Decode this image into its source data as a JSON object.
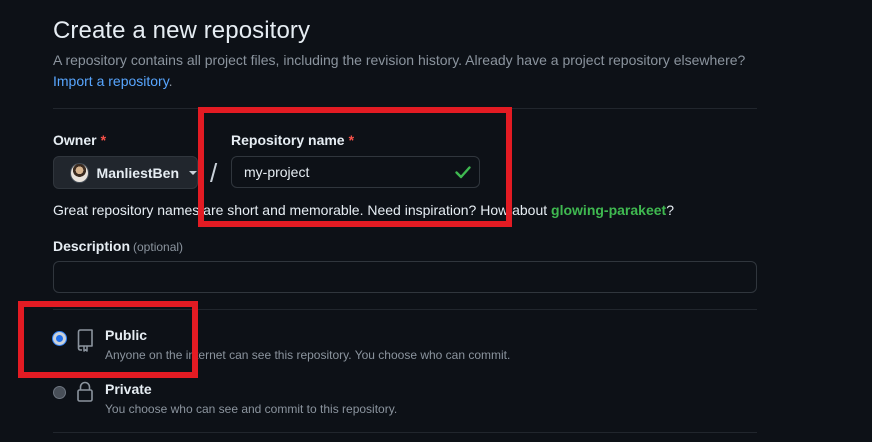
{
  "page": {
    "title": "Create a new repository",
    "subtitle": "A repository contains all project files, including the revision history. Already have a project repository elsewhere?",
    "import_link": "Import a repository",
    "import_suffix": "."
  },
  "owner": {
    "label": "Owner",
    "required_mark": "*",
    "value": "ManliestBen"
  },
  "separator": "/",
  "repo_name": {
    "label": "Repository name",
    "required_mark": "*",
    "value": "my-project",
    "status": "valid"
  },
  "hint": {
    "prefix": "Great repository names are short and memorable. Need inspiration? How about",
    "suggestion": "glowing-parakeet",
    "suffix": "?"
  },
  "description": {
    "label": "Description",
    "optional": "(optional)",
    "value": ""
  },
  "visibility": {
    "options": [
      {
        "label": "Public",
        "description": "Anyone on the internet can see this repository. You choose who can commit.",
        "selected": true,
        "icon": "repo-book-icon"
      },
      {
        "label": "Private",
        "description": "You choose who can see and commit to this repository.",
        "selected": false,
        "icon": "lock-icon"
      }
    ]
  },
  "colors": {
    "background": "#0d1117",
    "link": "#58a6ff",
    "success": "#3fb950",
    "required": "#f85149",
    "highlight": "#e31b23"
  }
}
